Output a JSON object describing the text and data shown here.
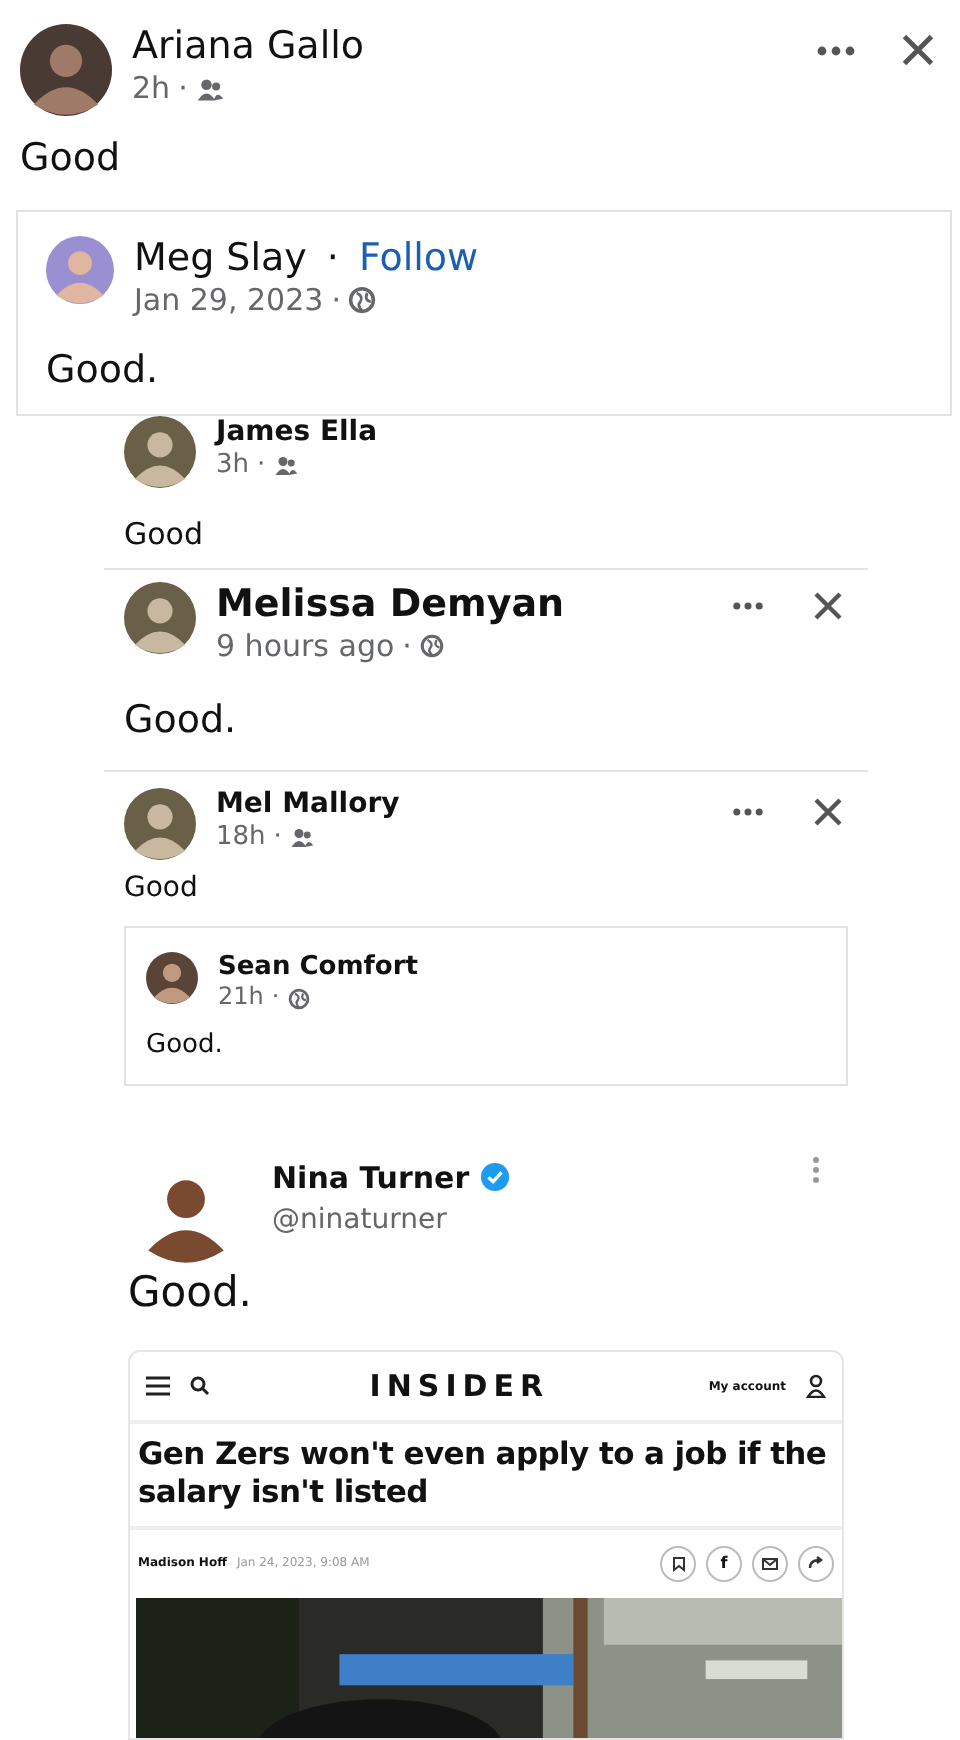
{
  "post": {
    "author": "Ariana Gallo",
    "time": "2h",
    "separator": "·",
    "public": false,
    "text": "Good",
    "shared": {
      "author": "Meg Slay",
      "follow_separator": "·",
      "follow": "Follow",
      "time": "Jan 29, 2023",
      "separator": "·",
      "public": true,
      "text": "Good."
    }
  },
  "comments": [
    {
      "kind": "clipped",
      "author": "James Ella",
      "time": "3h",
      "separator": "·",
      "public": false,
      "text": "Good"
    },
    {
      "kind": "large",
      "author": "Melissa Demyan",
      "time": "9 hours ago",
      "separator": "·",
      "public": true,
      "text": "Good."
    },
    {
      "kind": "small",
      "author": "Mel Mallory",
      "time": "18h",
      "separator": "·",
      "public": false,
      "text": "Good",
      "shared": {
        "author": "Sean Comfort",
        "time": "21h",
        "separator": "·",
        "public": true,
        "text": "Good."
      }
    }
  ],
  "tweet": {
    "author": "Nina Turner",
    "verified": true,
    "handle": "@ninaturner",
    "text": "Good.",
    "article": {
      "brand": "INSIDER",
      "account": "My account",
      "headline": "Gen Zers won't even apply to a job if the salary isn't listed",
      "byline": "Madison Hoff",
      "date": "Jan 24, 2023, 9:08 AM",
      "share_letter": "f"
    }
  }
}
